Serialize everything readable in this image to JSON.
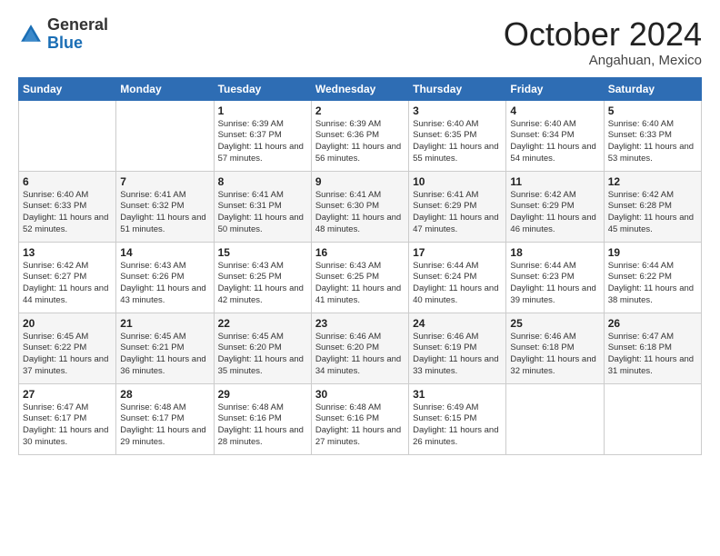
{
  "logo": {
    "general": "General",
    "blue": "Blue"
  },
  "title": "October 2024",
  "location": "Angahuan, Mexico",
  "days_of_week": [
    "Sunday",
    "Monday",
    "Tuesday",
    "Wednesday",
    "Thursday",
    "Friday",
    "Saturday"
  ],
  "weeks": [
    [
      {
        "day": "",
        "info": ""
      },
      {
        "day": "",
        "info": ""
      },
      {
        "day": "1",
        "info": "Sunrise: 6:39 AM\nSunset: 6:37 PM\nDaylight: 11 hours and 57 minutes."
      },
      {
        "day": "2",
        "info": "Sunrise: 6:39 AM\nSunset: 6:36 PM\nDaylight: 11 hours and 56 minutes."
      },
      {
        "day": "3",
        "info": "Sunrise: 6:40 AM\nSunset: 6:35 PM\nDaylight: 11 hours and 55 minutes."
      },
      {
        "day": "4",
        "info": "Sunrise: 6:40 AM\nSunset: 6:34 PM\nDaylight: 11 hours and 54 minutes."
      },
      {
        "day": "5",
        "info": "Sunrise: 6:40 AM\nSunset: 6:33 PM\nDaylight: 11 hours and 53 minutes."
      }
    ],
    [
      {
        "day": "6",
        "info": "Sunrise: 6:40 AM\nSunset: 6:33 PM\nDaylight: 11 hours and 52 minutes."
      },
      {
        "day": "7",
        "info": "Sunrise: 6:41 AM\nSunset: 6:32 PM\nDaylight: 11 hours and 51 minutes."
      },
      {
        "day": "8",
        "info": "Sunrise: 6:41 AM\nSunset: 6:31 PM\nDaylight: 11 hours and 50 minutes."
      },
      {
        "day": "9",
        "info": "Sunrise: 6:41 AM\nSunset: 6:30 PM\nDaylight: 11 hours and 48 minutes."
      },
      {
        "day": "10",
        "info": "Sunrise: 6:41 AM\nSunset: 6:29 PM\nDaylight: 11 hours and 47 minutes."
      },
      {
        "day": "11",
        "info": "Sunrise: 6:42 AM\nSunset: 6:29 PM\nDaylight: 11 hours and 46 minutes."
      },
      {
        "day": "12",
        "info": "Sunrise: 6:42 AM\nSunset: 6:28 PM\nDaylight: 11 hours and 45 minutes."
      }
    ],
    [
      {
        "day": "13",
        "info": "Sunrise: 6:42 AM\nSunset: 6:27 PM\nDaylight: 11 hours and 44 minutes."
      },
      {
        "day": "14",
        "info": "Sunrise: 6:43 AM\nSunset: 6:26 PM\nDaylight: 11 hours and 43 minutes."
      },
      {
        "day": "15",
        "info": "Sunrise: 6:43 AM\nSunset: 6:25 PM\nDaylight: 11 hours and 42 minutes."
      },
      {
        "day": "16",
        "info": "Sunrise: 6:43 AM\nSunset: 6:25 PM\nDaylight: 11 hours and 41 minutes."
      },
      {
        "day": "17",
        "info": "Sunrise: 6:44 AM\nSunset: 6:24 PM\nDaylight: 11 hours and 40 minutes."
      },
      {
        "day": "18",
        "info": "Sunrise: 6:44 AM\nSunset: 6:23 PM\nDaylight: 11 hours and 39 minutes."
      },
      {
        "day": "19",
        "info": "Sunrise: 6:44 AM\nSunset: 6:22 PM\nDaylight: 11 hours and 38 minutes."
      }
    ],
    [
      {
        "day": "20",
        "info": "Sunrise: 6:45 AM\nSunset: 6:22 PM\nDaylight: 11 hours and 37 minutes."
      },
      {
        "day": "21",
        "info": "Sunrise: 6:45 AM\nSunset: 6:21 PM\nDaylight: 11 hours and 36 minutes."
      },
      {
        "day": "22",
        "info": "Sunrise: 6:45 AM\nSunset: 6:20 PM\nDaylight: 11 hours and 35 minutes."
      },
      {
        "day": "23",
        "info": "Sunrise: 6:46 AM\nSunset: 6:20 PM\nDaylight: 11 hours and 34 minutes."
      },
      {
        "day": "24",
        "info": "Sunrise: 6:46 AM\nSunset: 6:19 PM\nDaylight: 11 hours and 33 minutes."
      },
      {
        "day": "25",
        "info": "Sunrise: 6:46 AM\nSunset: 6:18 PM\nDaylight: 11 hours and 32 minutes."
      },
      {
        "day": "26",
        "info": "Sunrise: 6:47 AM\nSunset: 6:18 PM\nDaylight: 11 hours and 31 minutes."
      }
    ],
    [
      {
        "day": "27",
        "info": "Sunrise: 6:47 AM\nSunset: 6:17 PM\nDaylight: 11 hours and 30 minutes."
      },
      {
        "day": "28",
        "info": "Sunrise: 6:48 AM\nSunset: 6:17 PM\nDaylight: 11 hours and 29 minutes."
      },
      {
        "day": "29",
        "info": "Sunrise: 6:48 AM\nSunset: 6:16 PM\nDaylight: 11 hours and 28 minutes."
      },
      {
        "day": "30",
        "info": "Sunrise: 6:48 AM\nSunset: 6:16 PM\nDaylight: 11 hours and 27 minutes."
      },
      {
        "day": "31",
        "info": "Sunrise: 6:49 AM\nSunset: 6:15 PM\nDaylight: 11 hours and 26 minutes."
      },
      {
        "day": "",
        "info": ""
      },
      {
        "day": "",
        "info": ""
      }
    ]
  ]
}
